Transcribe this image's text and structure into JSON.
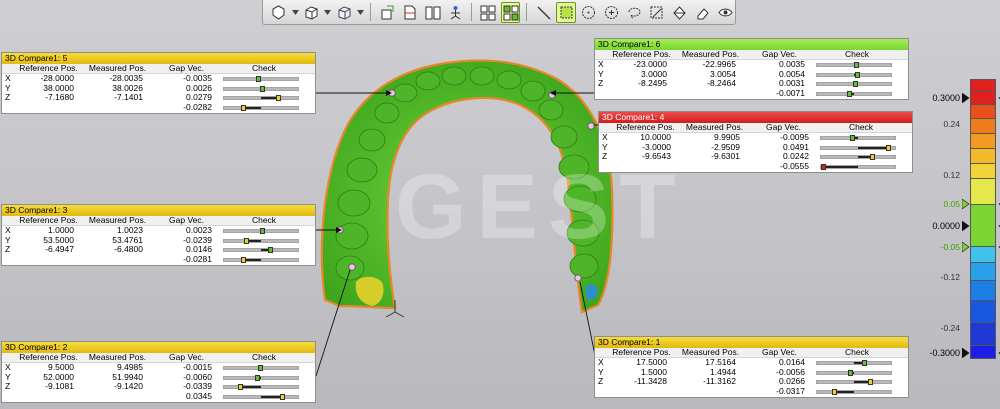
{
  "toolbar": {
    "buttons": [
      {
        "name": "surface-mode-icon",
        "active": false,
        "dropdown": true
      },
      {
        "name": "cube-view-icon",
        "active": false,
        "dropdown": true
      },
      {
        "name": "wire-cube-icon",
        "active": false,
        "dropdown": true
      },
      {
        "name": "clipping-plane-icon",
        "active": false
      },
      {
        "name": "section-view-icon",
        "active": false
      },
      {
        "name": "split-view-icon",
        "active": false
      },
      {
        "name": "align-icon",
        "active": false
      },
      {
        "name": "grid-icon",
        "active": false
      },
      {
        "name": "deviation-icon",
        "active": true
      },
      {
        "name": "line-select-icon",
        "active": false
      },
      {
        "name": "rectangle-select-icon",
        "active": true
      },
      {
        "name": "circle-select-icon",
        "active": false
      },
      {
        "name": "polygon-select-icon",
        "active": false
      },
      {
        "name": "lasso-select-icon",
        "active": false
      },
      {
        "name": "brush-select-icon",
        "active": false
      },
      {
        "name": "fill-select-icon",
        "active": false
      },
      {
        "name": "eraser-icon",
        "active": false
      },
      {
        "name": "eye-icon",
        "active": false
      }
    ]
  },
  "watermark": "GEST",
  "panels": [
    {
      "id": "compare5",
      "title": "3D Compare1: 5",
      "status": "yellow",
      "headers": [
        "Reference Pos.",
        "Measured Pos.",
        "Gap Vec.",
        "Check"
      ],
      "rows": [
        {
          "axis": "X",
          "ref": "-28.0000",
          "meas": "-28.0035",
          "gap": "-0.0035",
          "level": -0.0035
        },
        {
          "axis": "Y",
          "ref": "38.0000",
          "meas": "38.0026",
          "gap": "0.0026",
          "level": 0.0026
        },
        {
          "axis": "Z",
          "ref": "-7.1680",
          "meas": "-7.1401",
          "gap": "0.0279",
          "level": 0.0279
        }
      ],
      "total": {
        "gap": "-0.0282",
        "level": -0.0282
      }
    },
    {
      "id": "compare6",
      "title": "3D Compare1: 6",
      "status": "green",
      "headers": [
        "Reference Pos.",
        "Measured Pos.",
        "Gap Vec.",
        "Check"
      ],
      "rows": [
        {
          "axis": "X",
          "ref": "-23.0000",
          "meas": "-22.9965",
          "gap": "0.0035",
          "level": 0.0035
        },
        {
          "axis": "Y",
          "ref": "3.0000",
          "meas": "3.0054",
          "gap": "0.0054",
          "level": 0.0054
        },
        {
          "axis": "Z",
          "ref": "-8.2495",
          "meas": "-8.2464",
          "gap": "0.0031",
          "level": 0.0031
        }
      ],
      "total": {
        "gap": "-0.0071",
        "level": -0.0071
      }
    },
    {
      "id": "compare4",
      "title": "3D Compare1: 4",
      "status": "red",
      "headers": [
        "Reference Pos.",
        "Measured Pos.",
        "Gap Vec.",
        "Check"
      ],
      "rows": [
        {
          "axis": "X",
          "ref": "10.0000",
          "meas": "9.9905",
          "gap": "-0.0095",
          "level": -0.0095
        },
        {
          "axis": "Y",
          "ref": "-3.0000",
          "meas": "-2.9509",
          "gap": "0.0491",
          "level": 0.0491
        },
        {
          "axis": "Z",
          "ref": "-9.6543",
          "meas": "-9.6301",
          "gap": "0.0242",
          "level": 0.0242
        }
      ],
      "total": {
        "gap": "-0.0555",
        "level": -0.0555
      }
    },
    {
      "id": "compare3",
      "title": "3D Compare1: 3",
      "status": "yellow",
      "headers": [
        "Reference Pos.",
        "Measured Pos.",
        "Gap Vec.",
        "Check"
      ],
      "rows": [
        {
          "axis": "X",
          "ref": "1.0000",
          "meas": "1.0023",
          "gap": "0.0023",
          "level": 0.0023
        },
        {
          "axis": "Y",
          "ref": "53.5000",
          "meas": "53.4761",
          "gap": "-0.0239",
          "level": -0.0239
        },
        {
          "axis": "Z",
          "ref": "-6.4947",
          "meas": "-6.4800",
          "gap": "0.0146",
          "level": 0.0146
        }
      ],
      "total": {
        "gap": "-0.0281",
        "level": -0.0281
      }
    },
    {
      "id": "compare2",
      "title": "3D Compare1: 2",
      "status": "yellow",
      "headers": [
        "Reference Pos.",
        "Measured Pos.",
        "Gap Vec.",
        "Check"
      ],
      "rows": [
        {
          "axis": "X",
          "ref": "9.5000",
          "meas": "9.4985",
          "gap": "-0.0015",
          "level": -0.0015
        },
        {
          "axis": "Y",
          "ref": "52.0000",
          "meas": "51.9940",
          "gap": "-0.0060",
          "level": -0.006
        },
        {
          "axis": "Z",
          "ref": "-9.1081",
          "meas": "-9.1420",
          "gap": "-0.0339",
          "level": -0.0339
        }
      ],
      "total": {
        "gap": "0.0345",
        "level": 0.0345
      }
    },
    {
      "id": "compare1",
      "title": "3D Compare1: 1",
      "status": "yellow",
      "headers": [
        "Reference Pos.",
        "Measured Pos.",
        "Gap Vec.",
        "Check"
      ],
      "rows": [
        {
          "axis": "X",
          "ref": "17.5000",
          "meas": "17.5164",
          "gap": "0.0164",
          "level": 0.0164
        },
        {
          "axis": "Y",
          "ref": "1.5000",
          "meas": "1.4944",
          "gap": "-0.0056",
          "level": -0.0056
        },
        {
          "axis": "Z",
          "ref": "-11.3428",
          "meas": "-11.3162",
          "gap": "0.0266",
          "level": 0.0266
        }
      ],
      "total": {
        "gap": "-0.0317",
        "level": -0.0317
      }
    }
  ],
  "scale": {
    "labels": [
      {
        "text": "0.3000",
        "value": 0.3,
        "style": "big"
      },
      {
        "text": "0.24",
        "value": 0.24,
        "style": ""
      },
      {
        "text": "0.12",
        "value": 0.12,
        "style": ""
      },
      {
        "text": "0.05",
        "value": 0.05,
        "style": "green"
      },
      {
        "text": "0.0000",
        "value": 0.0,
        "style": "big"
      },
      {
        "text": "-0.05",
        "value": -0.05,
        "style": "green"
      },
      {
        "text": "-0.12",
        "value": -0.12,
        "style": ""
      },
      {
        "text": "-0.24",
        "value": -0.24,
        "style": ""
      },
      {
        "text": "-0.3000",
        "value": -0.3,
        "style": "big"
      }
    ],
    "colors": [
      "#e0201e",
      "#e9501c",
      "#ef7b1d",
      "#f29b22",
      "#f4b82a",
      "#f2d33a",
      "#e4e84a",
      "#7ad533",
      "#40c3ea",
      "#2aa0ea",
      "#1d7ee8",
      "#1857e0",
      "#1f39d6",
      "#1c1ee6"
    ],
    "accent_green": "#7ad533",
    "out_high": "#e0201e",
    "out_low": "#1c1ee6"
  },
  "model": {
    "base_color": "#58c22f",
    "edge_color": "#e8862a",
    "deviation_colors": [
      "#e8d32a",
      "#2a8be8"
    ]
  }
}
